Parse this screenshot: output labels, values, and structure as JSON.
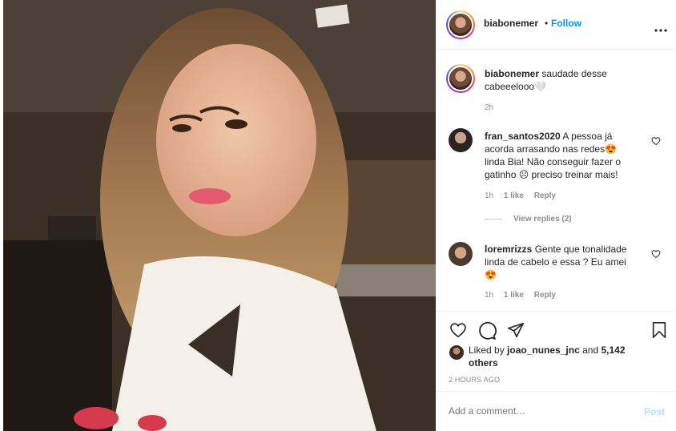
{
  "post": {
    "username": "biabonemer",
    "follow_separator": "•",
    "follow_label": "Follow",
    "more_icon": "more-options-icon"
  },
  "caption": {
    "username": "biabonemer",
    "text": "saudade desse cabeeelooo🤍",
    "time": "2h"
  },
  "comments": [
    {
      "username": "fran_santos2020",
      "text": "A pessoa já acorda arrasando nas redes😍 linda Bia! Não conseguir fazer o gatinho ☹ preciso treinar mais!",
      "time": "1h",
      "likes": "1 like",
      "reply": "Reply",
      "view_replies": "View replies (2)"
    },
    {
      "username": "loremrizzs",
      "text": "Gente que tonalidade linda de cabelo e essa ? Eu amei 😍",
      "time": "1h",
      "likes": "1 like",
      "reply": "Reply"
    }
  ],
  "likes": {
    "prefix": "Liked by",
    "user": "joao_nunes_jnc",
    "conjunction": "and",
    "others": "5,142 others"
  },
  "timestamp": "2 HOURS AGO",
  "add_comment": {
    "placeholder": "Add a comment…",
    "post_label": "Post"
  },
  "colors": {
    "accent": "#0095f6",
    "muted": "#8e8e8e",
    "text": "#262626"
  }
}
